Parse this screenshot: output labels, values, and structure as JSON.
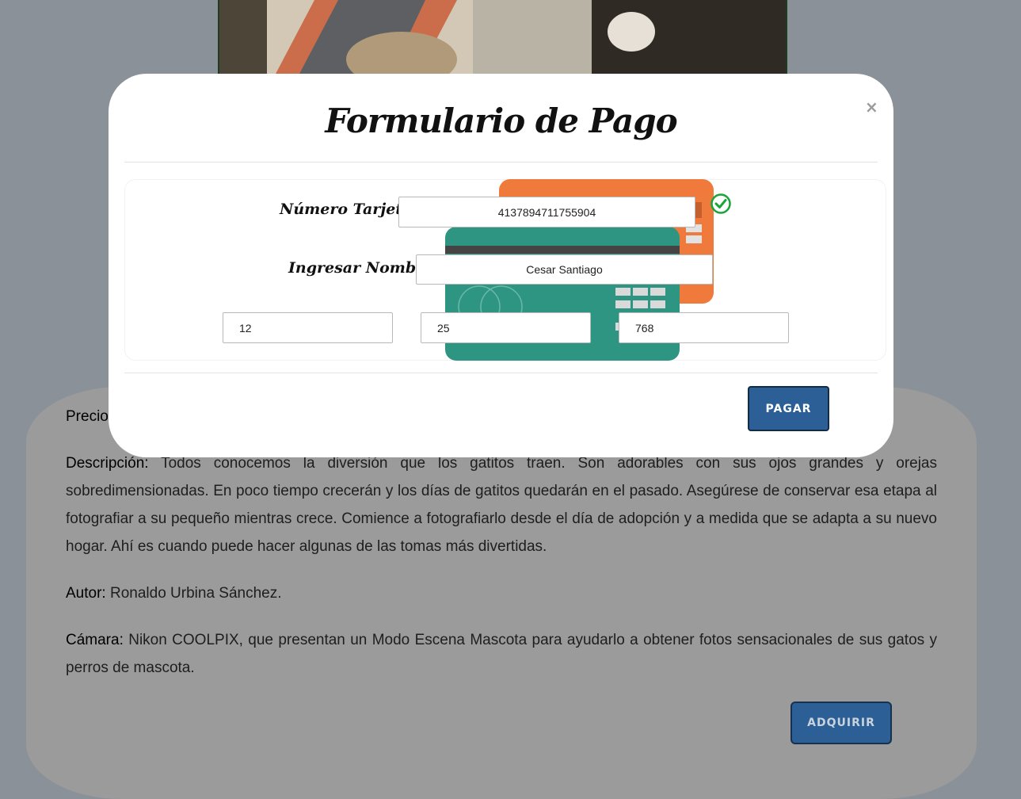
{
  "modal": {
    "title": "Formulario de Pago",
    "close_label": "×",
    "card_number_label": "Número Tarjeta:",
    "card_number_value": "4137894711755904",
    "name_label": "Ingresar Nombre:",
    "name_value": "Cesar Santiago",
    "expiry_month": "12",
    "expiry_year": "25",
    "cvv": "768",
    "pay_button": "PAGAR"
  },
  "product": {
    "price_label": "Precio",
    "description_label": "Descripción:",
    "description_text": "Todos conocemos la diversión que los gatitos traen. Son adorables con sus ojos grandes y orejas sobredimensionadas. En poco tiempo crecerán y los días de gatitos quedarán en el pasado. Asegúrese de conservar esa etapa al fotografiar a su pequeño mientras crece. Comience a fotografiarlo desde el día de adopción y a medida que se adapta a su nuevo hogar. Ahí es cuando puede hacer algunas de las tomas más divertidas.",
    "author_label": "Autor:",
    "author_value": "Ronaldo Urbina Sánchez.",
    "camera_label": "Cámara:",
    "camera_value": "Nikon COOLPIX, que presentan un Modo Escena Mascota para ayudarlo a obtener fotos sensacionales de sus gatos y perros de mascota.",
    "buy_button": "ADQUIRIR"
  },
  "colors": {
    "overlay": "#8a9198",
    "button_blue": "#2b5f96",
    "card_orange": "#f07a3c",
    "card_teal": "#2e9582",
    "check_green": "#1aa53a"
  },
  "icons": {
    "close": "close-icon",
    "valid": "check-circle-icon"
  }
}
